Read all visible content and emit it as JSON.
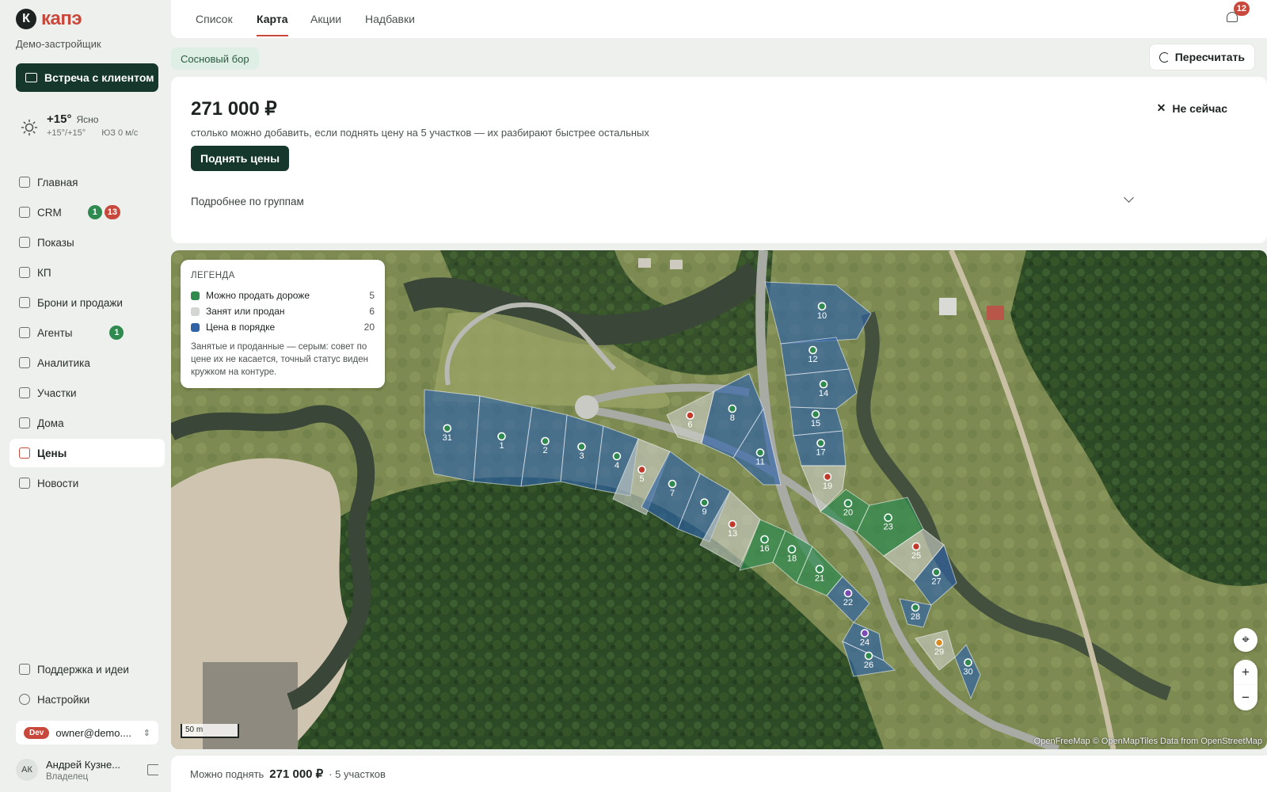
{
  "app": {
    "logo_letter": "К",
    "logo_text": "капэ",
    "developer": "Демо-застройщик",
    "meet_button": "Встреча с клиентом"
  },
  "weather": {
    "temp": "+15°",
    "condition": "Ясно",
    "range": "+15°/+15°",
    "wind": "ЮЗ 0 м/с"
  },
  "nav": {
    "items": [
      {
        "label": "Главная",
        "icon": "home-grid-icon"
      },
      {
        "label": "CRM",
        "icon": "crm-icon",
        "badges": [
          "1",
          "13"
        ]
      },
      {
        "label": "Показы",
        "icon": "monitor-icon"
      },
      {
        "label": "КП",
        "icon": "document-icon"
      },
      {
        "label": "Брони и продажи",
        "icon": "handshake-icon"
      },
      {
        "label": "Агенты",
        "icon": "building-icon",
        "badges": [
          "1"
        ]
      },
      {
        "label": "Аналитика",
        "icon": "chart-icon"
      },
      {
        "label": "Участки",
        "icon": "plots-icon"
      },
      {
        "label": "Дома",
        "icon": "house-icon"
      },
      {
        "label": "Цены",
        "icon": "price-tag-icon",
        "active": true
      },
      {
        "label": "Новости",
        "icon": "megaphone-icon"
      }
    ],
    "support": "Поддержка и идеи",
    "settings": "Настройки"
  },
  "env": {
    "tag": "Dev",
    "account": "owner@demo...."
  },
  "user": {
    "initials": "АК",
    "name": "Андрей Кузне...",
    "role": "Владелец"
  },
  "tabs": [
    "Список",
    "Карта",
    "Акции",
    "Надбавки"
  ],
  "active_tab": "Карта",
  "notifications": "12",
  "project_chip": "Сосновый бор",
  "recalc_button": "Пересчитать",
  "advice": {
    "amount": "271 000 ₽",
    "description": "столько можно добавить, если поднять цену на 5 участков — их разбирают быстрее остальных",
    "raise_button": "Поднять цены",
    "dismiss": "Не сейчас",
    "groups_toggle": "Подробнее по группам"
  },
  "legend": {
    "title": "ЛЕГЕНДА",
    "items": [
      {
        "label": "Можно продать дороже",
        "count": "5",
        "color": "#2f8a4f"
      },
      {
        "label": "Занят или продан",
        "count": "6",
        "color": "#d3d6d3"
      },
      {
        "label": "Цена в порядке",
        "count": "20",
        "color": "#2f63a8"
      }
    ],
    "note": "Занятые и проданные — серым: совет по цене их не касается, точный статус виден кружком на контуре."
  },
  "map": {
    "scale_label": "50 m",
    "attribution": "OpenFreeMap © OpenMapTiles Data from OpenStreetMap",
    "plots": [
      {
        "id": "31",
        "group": "ok",
        "dot": "green"
      },
      {
        "id": "1",
        "group": "ok",
        "dot": "green"
      },
      {
        "id": "2",
        "group": "ok",
        "dot": "green"
      },
      {
        "id": "3",
        "group": "ok",
        "dot": "green"
      },
      {
        "id": "4",
        "group": "ok",
        "dot": "green"
      },
      {
        "id": "5",
        "group": "busy",
        "dot": "red"
      },
      {
        "id": "7",
        "group": "ok",
        "dot": "green"
      },
      {
        "id": "9",
        "group": "ok",
        "dot": "green"
      },
      {
        "id": "13",
        "group": "busy",
        "dot": "red"
      },
      {
        "id": "16",
        "group": "up",
        "dot": "green"
      },
      {
        "id": "18",
        "group": "up",
        "dot": "green"
      },
      {
        "id": "21",
        "group": "up",
        "dot": "green"
      },
      {
        "id": "22",
        "group": "ok",
        "dot": "purple"
      },
      {
        "id": "24",
        "group": "ok",
        "dot": "purple"
      },
      {
        "id": "26",
        "group": "ok",
        "dot": "green"
      },
      {
        "id": "6",
        "group": "busy",
        "dot": "red"
      },
      {
        "id": "8",
        "group": "ok",
        "dot": "green"
      },
      {
        "id": "11",
        "group": "ok",
        "dot": "green"
      },
      {
        "id": "10",
        "group": "ok",
        "dot": "green"
      },
      {
        "id": "12",
        "group": "ok",
        "dot": "green"
      },
      {
        "id": "14",
        "group": "ok",
        "dot": "green"
      },
      {
        "id": "15",
        "group": "ok",
        "dot": "green"
      },
      {
        "id": "17",
        "group": "ok",
        "dot": "green"
      },
      {
        "id": "19",
        "group": "busy",
        "dot": "red"
      },
      {
        "id": "20",
        "group": "up",
        "dot": "green"
      },
      {
        "id": "23",
        "group": "up",
        "dot": "green"
      },
      {
        "id": "25",
        "group": "busy",
        "dot": "red"
      },
      {
        "id": "27",
        "group": "ok",
        "dot": "green"
      },
      {
        "id": "28",
        "group": "ok",
        "dot": "green"
      },
      {
        "id": "29",
        "group": "busy",
        "dot": "orange"
      },
      {
        "id": "30",
        "group": "ok",
        "dot": "green"
      }
    ]
  },
  "footer": {
    "label": "Можно поднять",
    "amount": "271 000 ₽",
    "suffix": "· 5 участков"
  }
}
